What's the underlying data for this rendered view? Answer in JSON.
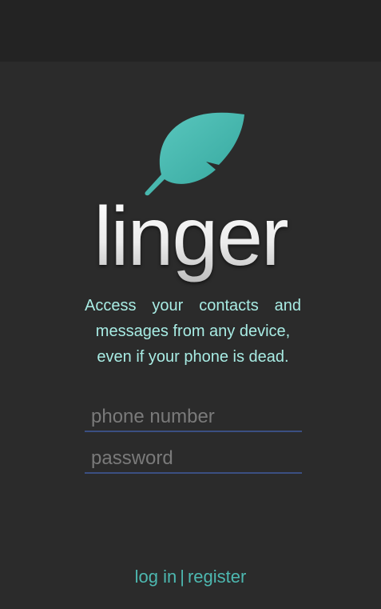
{
  "brand": {
    "name": "linger",
    "accent_color": "#4db8b0",
    "logo_icon": "leaf-icon"
  },
  "tagline": {
    "line1": "Access your contacts and",
    "line2": "messages from any device,",
    "line3": "even if your phone is dead."
  },
  "form": {
    "phone_placeholder": "phone number",
    "password_placeholder": "password"
  },
  "footer": {
    "login_label": "log in",
    "separator": "|",
    "register_label": "register"
  }
}
